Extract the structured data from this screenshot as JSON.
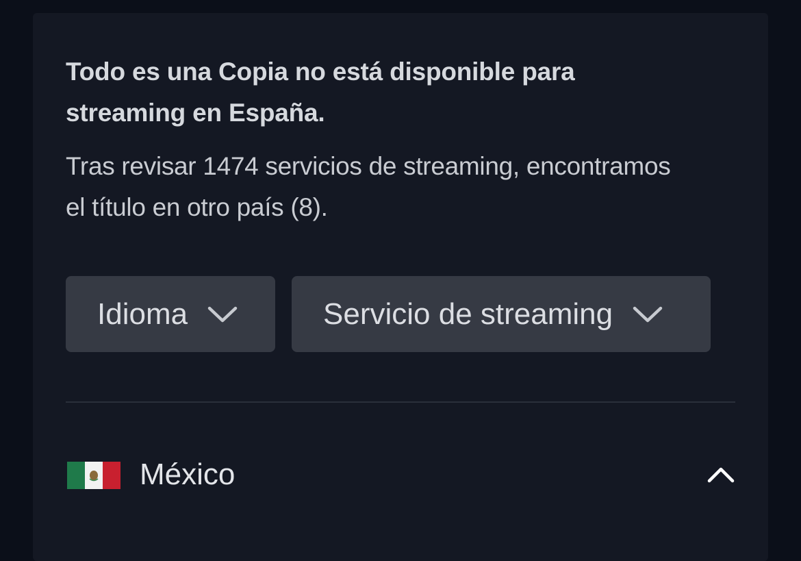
{
  "notice": {
    "headline": "Todo es una Copia no está disponible para streaming en España.",
    "detail": "Tras revisar 1474 servicios de streaming, encontramos el título en otro país (8)."
  },
  "filters": {
    "language_label": "Idioma",
    "service_label": "Servicio de streaming"
  },
  "countries": [
    {
      "name": "México",
      "flag_icon": "mexico-flag-icon",
      "expanded": true
    }
  ],
  "colors": {
    "page_bg": "#0b0f19",
    "card_bg": "#141823",
    "button_bg": "#363a44",
    "text_primary": "#d6d9de"
  }
}
